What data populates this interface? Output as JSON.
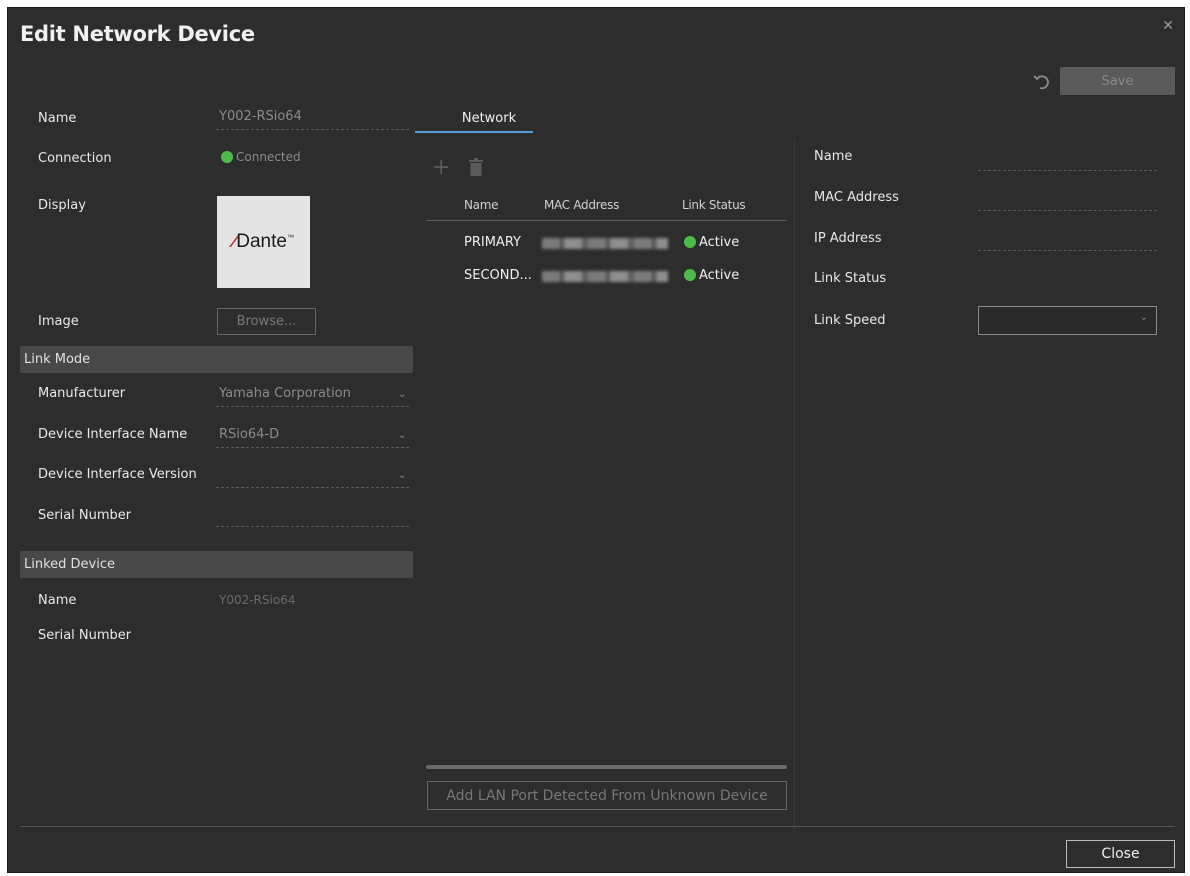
{
  "dialog": {
    "title": "Edit Network Device",
    "save_label": "Save",
    "close_label": "Close"
  },
  "device": {
    "name_label": "Name",
    "name_value": "Y002-RSio64",
    "connection_label": "Connection",
    "connection_value": "Connected",
    "display_label": "Display",
    "display_logo": "Dante",
    "image_label": "Image",
    "browse_label": "Browse..."
  },
  "link_mode": {
    "header": "Link Mode",
    "manufacturer_label": "Manufacturer",
    "manufacturer_value": "Yamaha Corporation",
    "interface_name_label": "Device Interface Name",
    "interface_name_value": "RSio64-D",
    "interface_version_label": "Device Interface Version",
    "interface_version_value": "",
    "serial_label": "Serial Number",
    "serial_value": ""
  },
  "linked_device": {
    "header": "Linked Device",
    "name_label": "Name",
    "name_value": "Y002-RSio64",
    "serial_label": "Serial Number",
    "serial_value": ""
  },
  "network": {
    "tab_label": "Network",
    "columns": [
      "Name",
      "MAC Address",
      "Link Status"
    ],
    "rows": [
      {
        "name": "PRIMARY",
        "status": "Active"
      },
      {
        "name": "SECOND...",
        "status": "Active"
      }
    ],
    "add_lan_label": "Add LAN Port Detected From Unknown Device"
  },
  "port_detail": {
    "name_label": "Name",
    "mac_label": "MAC Address",
    "ip_label": "IP Address",
    "link_status_label": "Link Status",
    "link_speed_label": "Link Speed",
    "link_speed_value": ""
  },
  "colors": {
    "status_green": "#4cbb4c",
    "tab_accent": "#5b9bd5",
    "background": "#2d2d2d"
  }
}
